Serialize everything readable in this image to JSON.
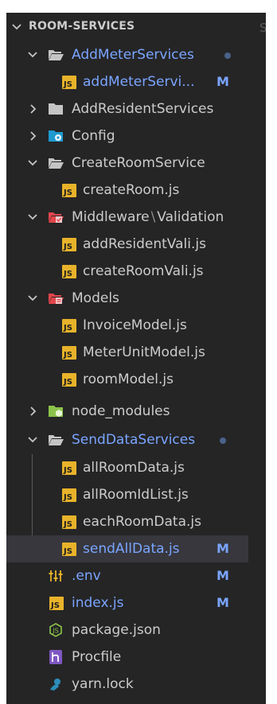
{
  "explorer": {
    "root": {
      "label": "ROOM-SERVICES",
      "right_glyph": "S"
    },
    "items": [
      {
        "label": "AddMeterServices",
        "type": "folder",
        "state": "expanded",
        "icon": "folder-open-icon",
        "modified": true
      },
      {
        "label": "addMeterServi...",
        "type": "file",
        "icon": "js-file-icon",
        "badge": "M",
        "modified": true
      },
      {
        "label": "AddResidentServices",
        "type": "folder",
        "state": "collapsed",
        "icon": "folder-icon"
      },
      {
        "label": "Config",
        "type": "folder",
        "state": "collapsed",
        "icon": "config-folder-icon"
      },
      {
        "label": "CreateRoomService",
        "type": "folder",
        "state": "expanded",
        "icon": "folder-open-icon"
      },
      {
        "label": "createRoom.js",
        "type": "file",
        "icon": "js-file-icon"
      },
      {
        "label": "Middleware",
        "label_sep": "\\",
        "label_tail": "Validation",
        "type": "folder",
        "state": "expanded",
        "icon": "middleware-folder-icon"
      },
      {
        "label": "addResidentVali.js",
        "type": "file",
        "icon": "js-file-icon"
      },
      {
        "label": "createRoomVali.js",
        "type": "file",
        "icon": "js-file-icon"
      },
      {
        "label": "Models",
        "type": "folder",
        "state": "expanded",
        "icon": "models-folder-icon"
      },
      {
        "label": "InvoiceModel.js",
        "type": "file",
        "icon": "js-file-icon"
      },
      {
        "label": "MeterUnitModel.js",
        "type": "file",
        "icon": "js-file-icon"
      },
      {
        "label": "roomModel.js",
        "type": "file",
        "icon": "js-file-icon"
      },
      {
        "label": "node_modules",
        "type": "folder",
        "state": "collapsed",
        "icon": "node-folder-icon"
      },
      {
        "label": "SendDataServices",
        "type": "folder",
        "state": "expanded",
        "icon": "folder-open-icon",
        "modified": true
      },
      {
        "label": "allRoomData.js",
        "type": "file",
        "icon": "js-file-icon"
      },
      {
        "label": "allRoomIdList.js",
        "type": "file",
        "icon": "js-file-icon"
      },
      {
        "label": "eachRoomData.js",
        "type": "file",
        "icon": "js-file-icon"
      },
      {
        "label": "sendAllData.js",
        "type": "file",
        "icon": "js-file-icon",
        "badge": "M",
        "modified": true,
        "selected": true
      },
      {
        "label": ".env",
        "type": "file",
        "icon": "env-settings-icon",
        "badge": "M",
        "modified": true
      },
      {
        "label": "index.js",
        "type": "file",
        "icon": "js-file-icon",
        "badge": "M",
        "modified": true
      },
      {
        "label": "package.json",
        "type": "file",
        "icon": "nodejs-icon"
      },
      {
        "label": "Procfile",
        "type": "file",
        "icon": "heroku-icon"
      },
      {
        "label": "yarn.lock",
        "type": "file",
        "icon": "yarn-icon"
      }
    ],
    "colors": {
      "background": "#252526",
      "text": "#cccccc",
      "modified": "#7aa5ff",
      "selected_row": "#37373d",
      "js_icon": "#e8b32a"
    }
  }
}
